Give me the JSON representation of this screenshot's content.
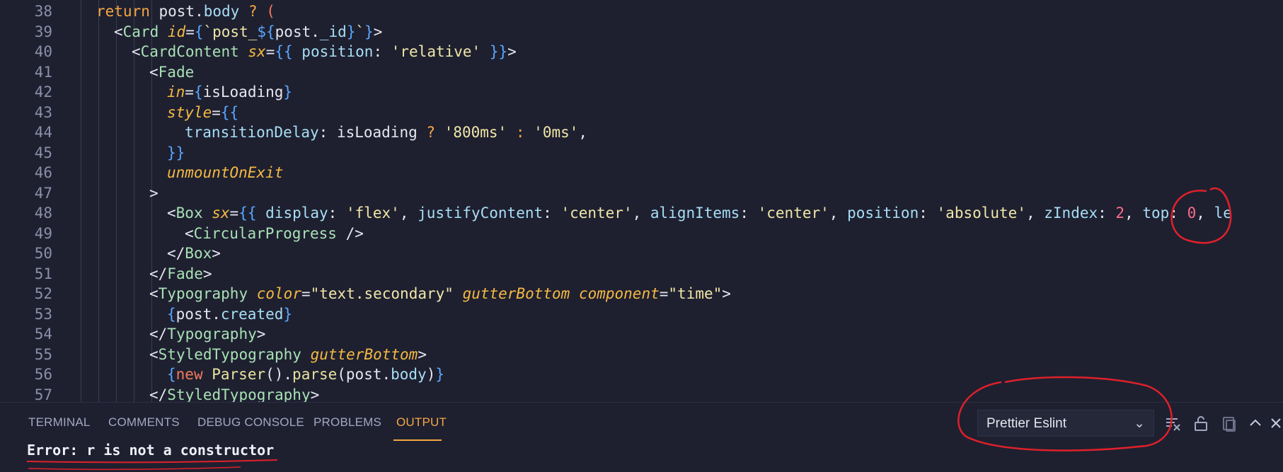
{
  "editor": {
    "lines": [
      {
        "n": "38",
        "indent": 0,
        "html": "<span class=\"kw\">return</span> post.<span class=\"member\">body</span> <span class=\"ternary\">?</span> <span class=\"kw2\">(</span>"
      },
      {
        "n": "39",
        "indent": 1,
        "html": "&lt;<span class=\"tag\">Card</span> <span class=\"attr\">id</span>=<span class=\"brace\">{</span><span class=\"str\">`post_</span><span class=\"brace\">${</span>post.<span class=\"member\">_id</span><span class=\"brace\">}</span><span class=\"str\">`</span><span class=\"brace\">}</span>&gt;"
      },
      {
        "n": "40",
        "indent": 2,
        "html": "&lt;<span class=\"tag\">CardContent</span> <span class=\"attr\">sx</span>=<span class=\"brace\">{{</span> <span class=\"prop\">position</span>: <span class=\"str\">'relative'</span> <span class=\"brace\">}}</span>&gt;"
      },
      {
        "n": "41",
        "indent": 3,
        "html": "&lt;<span class=\"tag\">Fade</span>"
      },
      {
        "n": "42",
        "indent": 4,
        "html": "<span class=\"attr\">in</span>=<span class=\"brace\">{</span>isLoading<span class=\"brace\">}</span>"
      },
      {
        "n": "43",
        "indent": 4,
        "html": "<span class=\"attr\">style</span>=<span class=\"brace\">{{</span>"
      },
      {
        "n": "44",
        "indent": 5,
        "html": "<span class=\"prop\">transitionDelay</span>: isLoading <span class=\"ternary\">?</span> <span class=\"str\">'800ms'</span> <span class=\"ternary\">:</span> <span class=\"str\">'0ms'</span>,"
      },
      {
        "n": "45",
        "indent": 4,
        "html": "<span class=\"brace\">}}</span>"
      },
      {
        "n": "46",
        "indent": 4,
        "html": "<span class=\"attr\">unmountOnExit</span>"
      },
      {
        "n": "47",
        "indent": 3,
        "html": "&gt;"
      },
      {
        "n": "48",
        "indent": 4,
        "html": "&lt;<span class=\"tag\">Box</span> <span class=\"attr\">sx</span>=<span class=\"brace\">{{</span> <span class=\"prop\">display</span>: <span class=\"str\">'flex'</span>, <span class=\"prop\">justifyContent</span>: <span class=\"str\">'center'</span>, <span class=\"prop\">alignItems</span>: <span class=\"str\">'center'</span>, <span class=\"prop\">position</span>: <span class=\"str\">'absolute'</span>, <span class=\"prop\">zIndex</span>: <span class=\"num\">2</span>, <span class=\"prop\">top</span>: <span class=\"num\">0</span>, <span class=\"prop\">le</span>"
      },
      {
        "n": "49",
        "indent": 5,
        "html": "&lt;<span class=\"tag\">CircularProgress</span> /&gt;"
      },
      {
        "n": "50",
        "indent": 4,
        "html": "&lt;/<span class=\"tag\">Box</span>&gt;"
      },
      {
        "n": "51",
        "indent": 3,
        "html": "&lt;/<span class=\"tag\">Fade</span>&gt;"
      },
      {
        "n": "52",
        "indent": 3,
        "html": "&lt;<span class=\"tag\">Typography</span> <span class=\"attr\">color</span>=<span class=\"str\">\"text.secondary\"</span> <span class=\"attr\">gutterBottom</span> <span class=\"attr\">component</span>=<span class=\"str\">\"time\"</span>&gt;"
      },
      {
        "n": "53",
        "indent": 4,
        "html": "<span class=\"brace\">{</span>post.<span class=\"member\">created</span><span class=\"brace\">}</span>"
      },
      {
        "n": "54",
        "indent": 3,
        "html": "&lt;/<span class=\"tag\">Typography</span>&gt;"
      },
      {
        "n": "55",
        "indent": 3,
        "html": "&lt;<span class=\"tag\">StyledTypography</span> <span class=\"attr\">gutterBottom</span>&gt;"
      },
      {
        "n": "56",
        "indent": 4,
        "html": "<span class=\"brace\">{</span><span class=\"kw2\">new</span> <span class=\"fn\">Parser</span>().<span class=\"fn\">parse</span>(post.<span class=\"member\">body</span>)<span class=\"brace\">}</span>"
      },
      {
        "n": "57",
        "indent": 3,
        "html": "&lt;/<span class=\"tag\">StyledTypography</span>&gt;"
      }
    ]
  },
  "panel": {
    "tabs": [
      {
        "label": "TERMINAL",
        "name": "tab-terminal"
      },
      {
        "label": "COMMENTS",
        "name": "tab-comments"
      },
      {
        "label": "DEBUG CONSOLE",
        "name": "tab-debug-console"
      },
      {
        "label": "PROBLEMS",
        "name": "tab-problems"
      },
      {
        "label": "OUTPUT",
        "name": "tab-output",
        "active": true
      }
    ],
    "output_channel": "Prettier Eslint",
    "output_text": "Error: r is not a constructor",
    "tools": [
      "clear-output-icon",
      "lock-scroll-icon",
      "copy-output-icon",
      "maximize-panel-icon",
      "close-panel-icon"
    ]
  },
  "colors": {
    "accent": "#f5a742",
    "annotation": "#e0202a"
  }
}
